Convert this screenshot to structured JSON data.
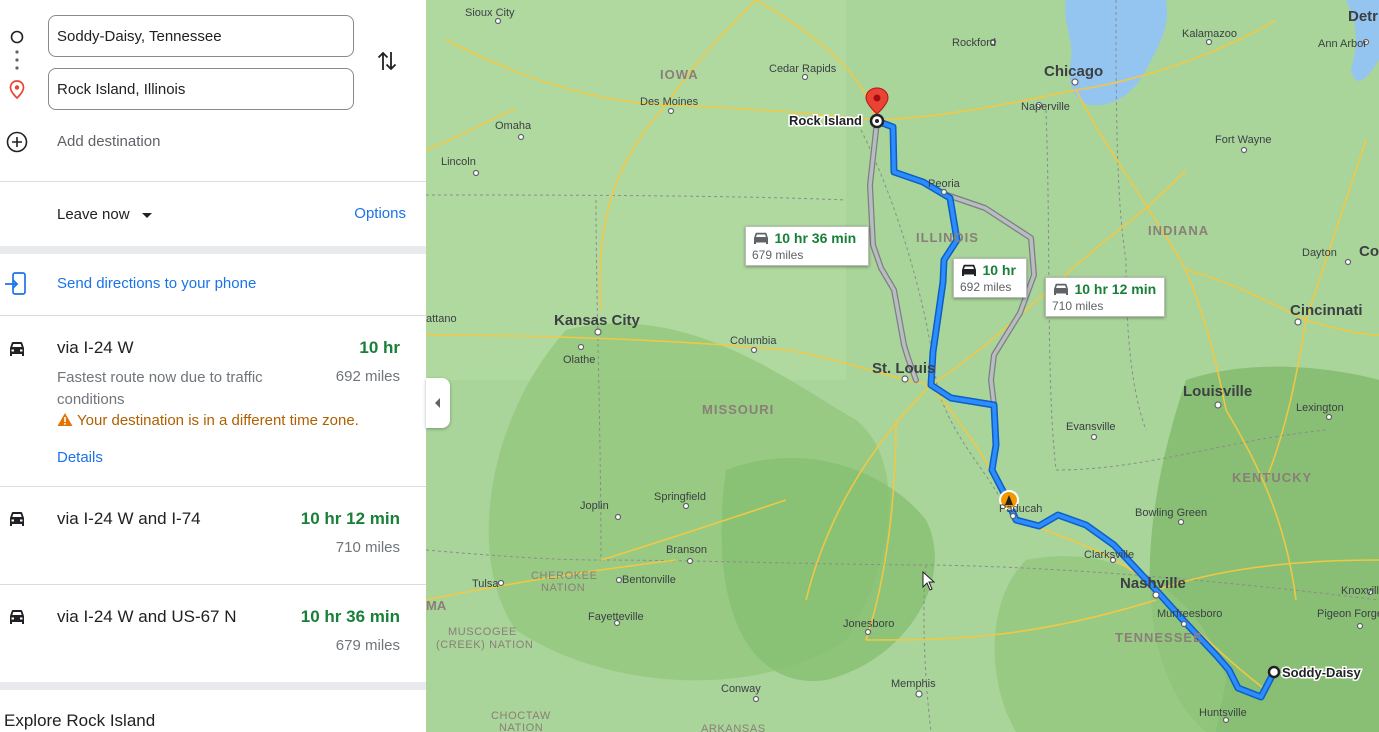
{
  "directions": {
    "origin": "Soddy-Daisy, Tennessee",
    "destination": "Rock Island, Illinois",
    "add_destination": "Add destination"
  },
  "options_bar": {
    "leave_now": "Leave now",
    "options": "Options"
  },
  "send_to_phone": "Send directions to your phone",
  "routes": [
    {
      "title": "via I-24 W",
      "time": "10 hr",
      "distance": "692 miles",
      "description": "Fastest route now due to traffic conditions",
      "warning": "Your destination is in a different time zone.",
      "details": "Details"
    },
    {
      "title": "via I-24 W and I-74",
      "time": "10 hr 12 min",
      "distance": "710 miles"
    },
    {
      "title": "via I-24 W and US-67 N",
      "time": "10 hr 36 min",
      "distance": "679 miles"
    }
  ],
  "explore": "Explore Rock Island",
  "map": {
    "callouts": [
      {
        "time": "10 hr 36 min",
        "distance": "679 miles"
      },
      {
        "time": "10 hr",
        "distance": "692 miles"
      },
      {
        "time": "10 hr 12 min",
        "distance": "710 miles"
      }
    ],
    "states": [
      "IOWA",
      "ILLINOIS",
      "INDIANA",
      "MISSOURI",
      "KENTUCKY",
      "TENNESSEE"
    ],
    "regions": [
      "CHEROKEE",
      "NATION",
      "MUSCOGEE",
      "(CREEK) NATION",
      "CHOCTAW",
      "NATION",
      "ARKANSAS",
      "MA"
    ],
    "major_cities": [
      "Chicago",
      "Kansas City",
      "St. Louis",
      "Louisville",
      "Cincinnati",
      "Nashville",
      "Detr",
      "Co"
    ],
    "route_cities": [
      "Rock Island",
      "Soddy-Daisy"
    ],
    "cities": [
      "Sioux City",
      "Rockford",
      "Kalamazoo",
      "Ann Arbor",
      "Cedar Rapids",
      "Des Moines",
      "Naperville",
      "Omaha",
      "Fort Wayne",
      "Lincoln",
      "Peoria",
      "Dayton",
      "Columbia",
      "Olathe",
      "Lexington",
      "Evansville",
      "Joplin",
      "Springfield",
      "Paducah",
      "Bowling Green",
      "Branson",
      "Clarksville",
      "Tulsa",
      "Bentonville",
      "Fayetteville",
      "Murfreesboro",
      "Knoxville",
      "Pigeon Forge",
      "Jonesboro",
      "Memphis",
      "Conway",
      "Huntsville",
      "attano"
    ],
    "colors": {
      "selected_route": "#1a73e8",
      "alt_route": "#9aa0a6",
      "water": "#94c5f0",
      "land": "#a9d49a"
    }
  }
}
